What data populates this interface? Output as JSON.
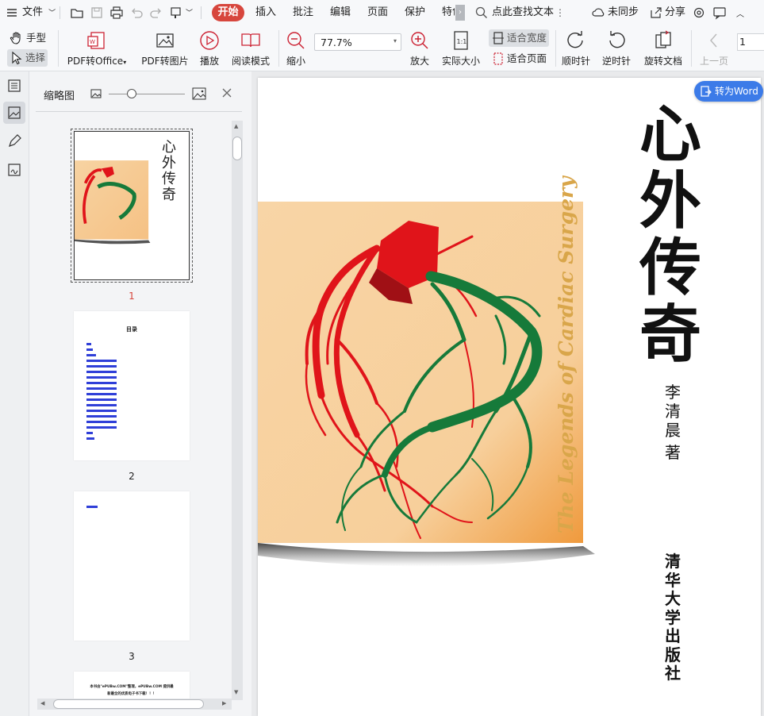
{
  "menubar": {
    "file_label": "文件",
    "start_label": "开始",
    "tabs": [
      "插入",
      "批注",
      "编辑",
      "页面",
      "保护",
      "特色"
    ],
    "search_label": "点此查找文本",
    "sync_label": "未同步",
    "share_label": "分享"
  },
  "ribbon": {
    "hand_label": "手型",
    "select_label": "选择",
    "pdf_to_office": "PDF转Office",
    "pdf_to_image": "PDF转图片",
    "play": "播放",
    "read_mode": "阅读模式",
    "zoom_out": "缩小",
    "zoom_value": "77.7%",
    "zoom_in": "放大",
    "actual_size": "实际大小",
    "fit_width": "适合宽度",
    "fit_page": "适合页面",
    "rotate_cw": "顺时针",
    "rotate_ccw": "逆时针",
    "rotate_doc": "旋转文档",
    "prev_page": "上一页",
    "page_input": "1"
  },
  "thumbnails": {
    "title": "缩略图",
    "slider_fraction": 0.3,
    "pages": [
      {
        "num": "1",
        "active": true
      },
      {
        "num": "2",
        "active": false
      },
      {
        "num": "3",
        "active": false
      }
    ],
    "toc_title": "目录",
    "page4_line1": "本书由\"ePUBw.COM\"整理，ePUBw.COM 提供最",
    "page4_line2": "新最全的优质电子书下载！！！"
  },
  "document": {
    "to_word_label": "转为Word",
    "title_chars": [
      "心",
      "外",
      "传",
      "奇"
    ],
    "english_title": "The Legends of Cardiac Surgery",
    "author_chars": [
      "李",
      "清",
      "晨"
    ],
    "author_suffix": "著",
    "publisher_chars": [
      "清",
      "华",
      "大",
      "学",
      "出",
      "版",
      "社"
    ]
  },
  "colors": {
    "accent_red": "#d7463d",
    "word_button": "#3c7be8",
    "gold_title": "#d9a64a",
    "heart_red": "#e0141a",
    "vessel_green": "#167a3a",
    "cover_peach": "#f7d3a2"
  }
}
